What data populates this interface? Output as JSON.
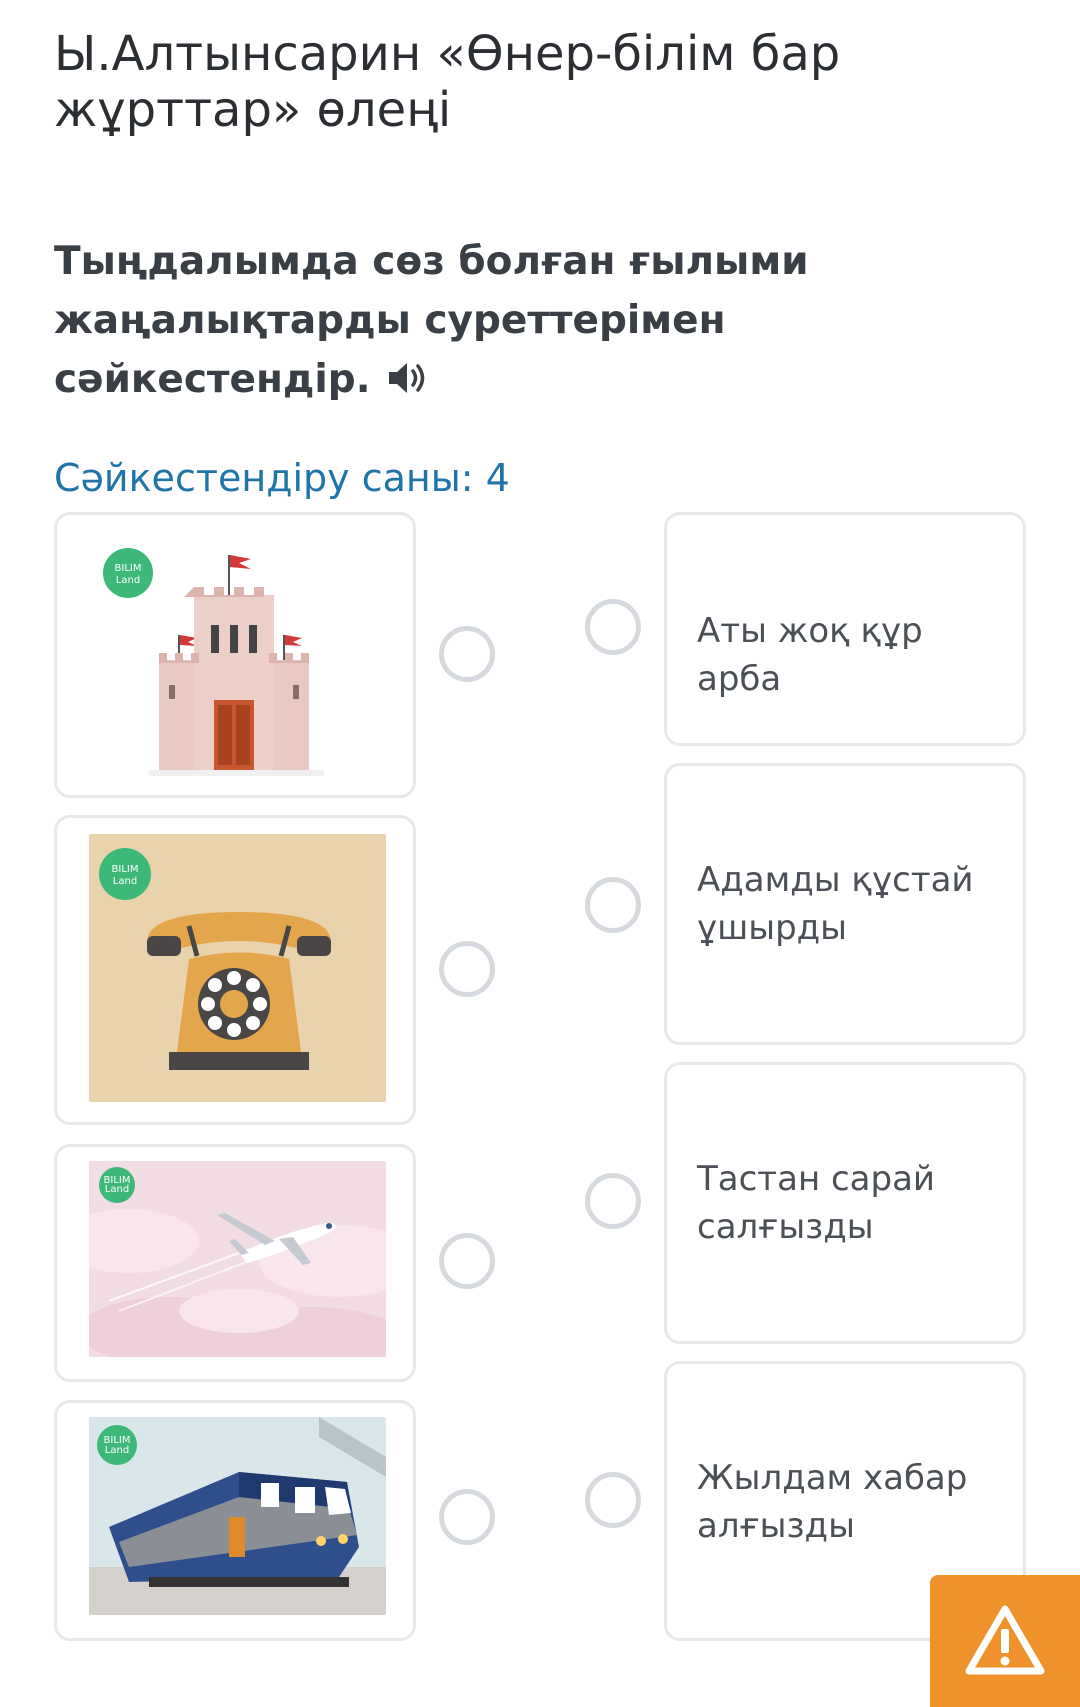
{
  "page": {
    "title": "Ы.Алтынсарин «Өнер-білім бар жұрттар» өлеңі"
  },
  "question": {
    "text": "Тыңдалымда сөз болған ғылыми жаңалықтарды суреттерімен сәйкестендір.",
    "audio_icon": "speaker-icon"
  },
  "match": {
    "count_label": "Сәйкестендіру саны: 4"
  },
  "image_items": [
    {
      "icon": "castle-image",
      "badge": [
        "BILIM",
        "Land"
      ]
    },
    {
      "icon": "telephone-image",
      "badge": [
        "BILIM",
        "Land"
      ]
    },
    {
      "icon": "airplane-image",
      "badge": [
        "BILIM",
        "Land"
      ]
    },
    {
      "icon": "train-image",
      "badge": [
        "BILIM",
        "Land"
      ]
    }
  ],
  "text_items": [
    {
      "label": "Аты жоқ құр арба"
    },
    {
      "label": "Адамды құстай ұшырды"
    },
    {
      "label": "Тастан сарай салғызды"
    },
    {
      "label": "Жылдам хабар алғызды"
    }
  ],
  "report": {
    "icon": "warning-icon",
    "color": "#f0922c"
  },
  "colors": {
    "accent": "#1f75a8",
    "title": "#2b2f33",
    "badge": "#3cb878"
  }
}
